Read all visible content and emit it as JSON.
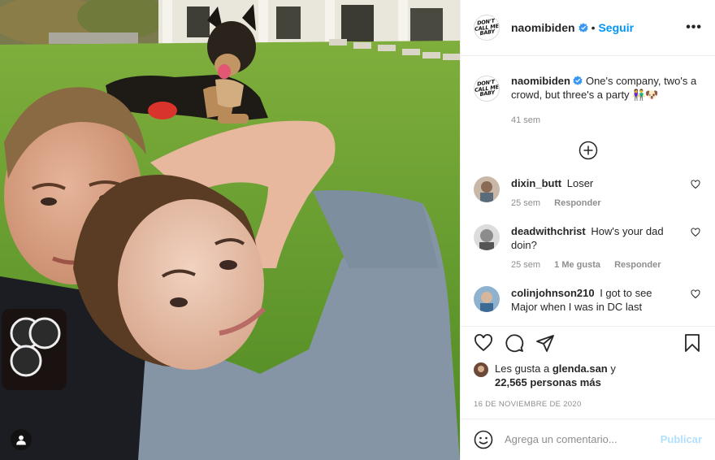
{
  "header": {
    "username": "naomibiden",
    "separator": "•",
    "follow_label": "Seguir",
    "more_label": "•••",
    "avatar_logo": [
      "DON'T",
      "CALL ME",
      "BABY"
    ]
  },
  "caption": {
    "username": "naomibiden",
    "text": "One's company, two's a crowd, but three's a party",
    "emojis": "👫🐶",
    "time": "41 sem"
  },
  "comments": [
    {
      "username": "dixin_butt",
      "text": "Loser",
      "time": "25 sem",
      "likes": "",
      "reply": "Responder"
    },
    {
      "username": "deadwithchrist",
      "text": "How's your dad doin?",
      "time": "25 sem",
      "likes": "1 Me gusta",
      "reply": "Responder"
    },
    {
      "username": "colinjohnson210",
      "text": "I got to see Major when I was in DC last",
      "time": "",
      "likes": "",
      "reply": ""
    }
  ],
  "likes": {
    "prefix": "Les gusta a",
    "user": "glenda.san",
    "conj": "y",
    "count": "22,565 personas más"
  },
  "date": "16 DE NOVIEMBRE DE 2020",
  "add_comment": {
    "placeholder": "Agrega un comentario...",
    "post_label": "Publicar"
  },
  "colors": {
    "accent": "#0095f6",
    "verified": "#3897f0",
    "muted": "#8e8e8e",
    "post_disabled": "#b2dffc"
  },
  "icons": [
    "tag-user-icon",
    "verified-badge-icon",
    "more-options-icon",
    "load-more-icon",
    "heart-icon",
    "comment-icon",
    "share-icon",
    "bookmark-icon",
    "emoji-icon"
  ]
}
